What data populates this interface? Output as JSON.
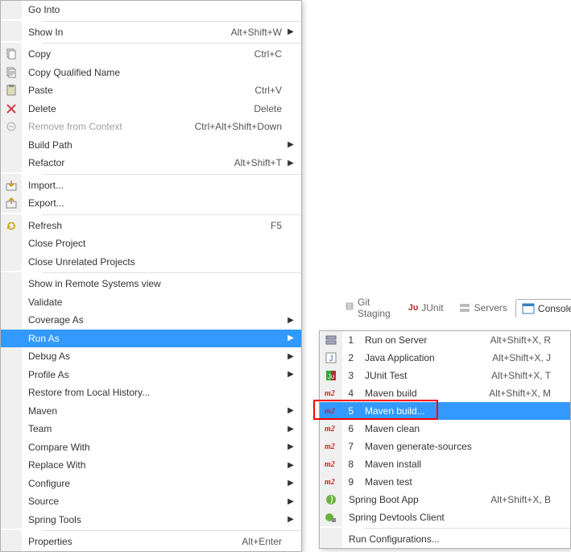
{
  "tabs": {
    "git_staging": "Git Staging",
    "junit": "JUnit",
    "servers": "Servers",
    "console": "Console"
  },
  "main": [
    {
      "type": "item",
      "label": "Go Into"
    },
    {
      "type": "sep"
    },
    {
      "type": "item",
      "label": "Show In",
      "accel": "Alt+Shift+W",
      "arrow": true
    },
    {
      "type": "sep"
    },
    {
      "type": "item",
      "label": "Copy",
      "accel": "Ctrl+C",
      "icon": "copy"
    },
    {
      "type": "item",
      "label": "Copy Qualified Name",
      "icon": "copy-qualified"
    },
    {
      "type": "item",
      "label": "Paste",
      "accel": "Ctrl+V",
      "icon": "paste"
    },
    {
      "type": "item",
      "label": "Delete",
      "accel": "Delete",
      "icon": "delete"
    },
    {
      "type": "item",
      "label": "Remove from Context",
      "accel": "Ctrl+Alt+Shift+Down",
      "icon": "remove-context",
      "disabled": true
    },
    {
      "type": "item",
      "label": "Build Path",
      "arrow": true
    },
    {
      "type": "item",
      "label": "Refactor",
      "accel": "Alt+Shift+T",
      "arrow": true
    },
    {
      "type": "sep"
    },
    {
      "type": "item",
      "label": "Import...",
      "icon": "import"
    },
    {
      "type": "item",
      "label": "Export...",
      "icon": "export"
    },
    {
      "type": "sep"
    },
    {
      "type": "item",
      "label": "Refresh",
      "accel": "F5",
      "icon": "refresh"
    },
    {
      "type": "item",
      "label": "Close Project"
    },
    {
      "type": "item",
      "label": "Close Unrelated Projects"
    },
    {
      "type": "sep"
    },
    {
      "type": "item",
      "label": "Show in Remote Systems view"
    },
    {
      "type": "item",
      "label": "Validate"
    },
    {
      "type": "item",
      "label": "Coverage As",
      "arrow": true
    },
    {
      "type": "item",
      "label": "Run As",
      "arrow": true,
      "highlighted": true
    },
    {
      "type": "item",
      "label": "Debug As",
      "arrow": true
    },
    {
      "type": "item",
      "label": "Profile As",
      "arrow": true
    },
    {
      "type": "item",
      "label": "Restore from Local History..."
    },
    {
      "type": "item",
      "label": "Maven",
      "arrow": true
    },
    {
      "type": "item",
      "label": "Team",
      "arrow": true
    },
    {
      "type": "item",
      "label": "Compare With",
      "arrow": true
    },
    {
      "type": "item",
      "label": "Replace With",
      "arrow": true
    },
    {
      "type": "item",
      "label": "Configure",
      "arrow": true
    },
    {
      "type": "item",
      "label": "Source",
      "arrow": true
    },
    {
      "type": "item",
      "label": "Spring Tools",
      "arrow": true
    },
    {
      "type": "sep"
    },
    {
      "type": "item",
      "label": "Properties",
      "accel": "Alt+Enter"
    }
  ],
  "sub": [
    {
      "type": "item",
      "num": "1",
      "label": "Run on Server",
      "accel": "Alt+Shift+X, R",
      "icon": "server"
    },
    {
      "type": "item",
      "num": "2",
      "label": "Java Application",
      "accel": "Alt+Shift+X, J",
      "icon": "java"
    },
    {
      "type": "item",
      "num": "3",
      "label": "JUnit Test",
      "accel": "Alt+Shift+X, T",
      "icon": "junit"
    },
    {
      "type": "item",
      "num": "4",
      "label": "Maven build",
      "accel": "Alt+Shift+X, M",
      "icon": "m2"
    },
    {
      "type": "item",
      "num": "5",
      "label": "Maven build...",
      "icon": "m2",
      "highlighted": true,
      "boxed": true
    },
    {
      "type": "item",
      "num": "6",
      "label": "Maven clean",
      "icon": "m2"
    },
    {
      "type": "item",
      "num": "7",
      "label": "Maven generate-sources",
      "icon": "m2"
    },
    {
      "type": "item",
      "num": "8",
      "label": "Maven install",
      "icon": "m2"
    },
    {
      "type": "item",
      "num": "9",
      "label": "Maven test",
      "icon": "m2"
    },
    {
      "type": "item",
      "label": "Spring Boot App",
      "accel": "Alt+Shift+X, B",
      "icon": "spring"
    },
    {
      "type": "item",
      "label": "Spring Devtools Client",
      "icon": "spring-dev"
    },
    {
      "type": "sep"
    },
    {
      "type": "item",
      "label": "Run Configurations..."
    }
  ]
}
